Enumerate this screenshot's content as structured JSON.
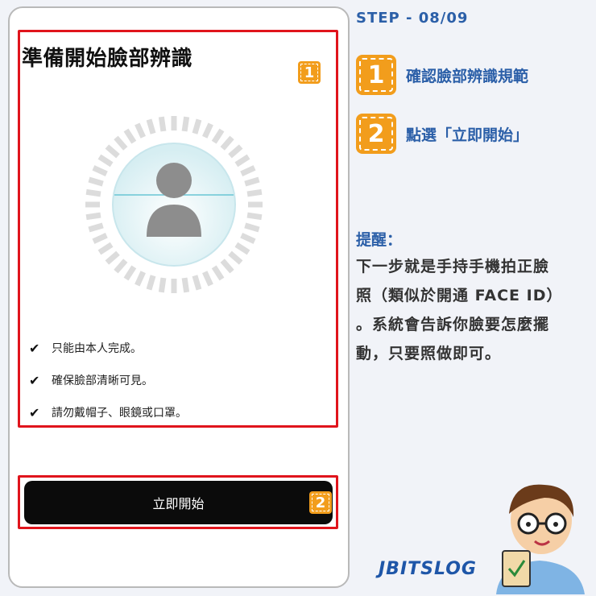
{
  "phone": {
    "title": "準備開始臉部辨識",
    "checklist": [
      "只能由本人完成。",
      "確保臉部清晰可見。",
      "請勿戴帽子、眼鏡或口罩。"
    ],
    "start_button": "立即開始",
    "check_icon": "✔"
  },
  "annotations": {
    "tag1": "1",
    "tag2": "2"
  },
  "guide": {
    "step_label": "STEP - 08/09",
    "steps": [
      {
        "num": "1",
        "text": "確認臉部辨識規範"
      },
      {
        "num": "2",
        "text": "點選「立即開始」"
      }
    ],
    "note_title": "提醒：",
    "note_lines": [
      "下一步就是手持手機拍正臉",
      "照（類似於開通 FACE ID）",
      "。系統會告訴你臉要怎麼擺",
      "動，只要照做即可。"
    ]
  },
  "brand": {
    "logo_text": "JBITSLOG",
    "accent": "#2b5fa8",
    "orange": "#f29d1c",
    "highlight_red": "#e0141c"
  }
}
